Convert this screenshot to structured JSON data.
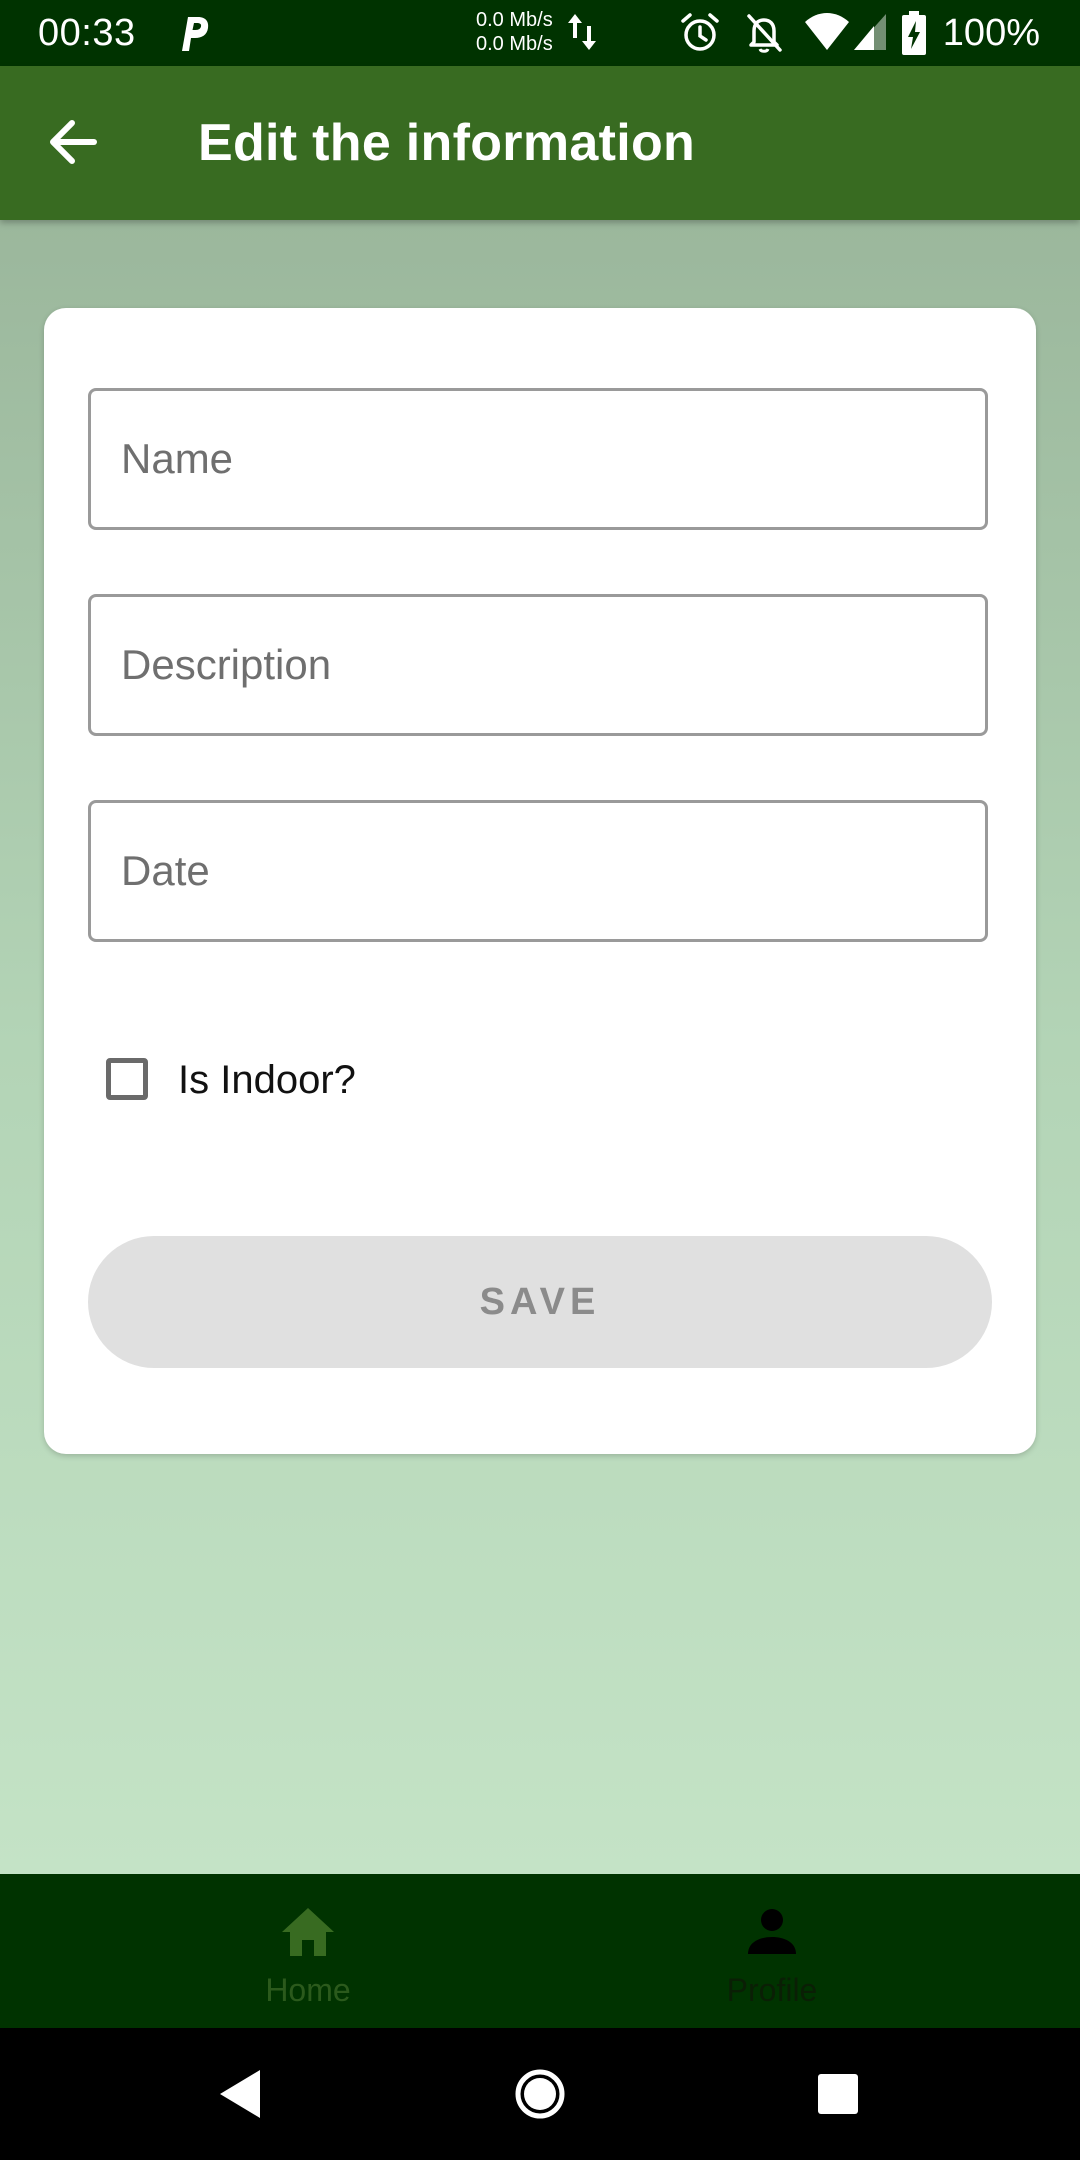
{
  "status_bar": {
    "time": "00:33",
    "net_up": "0.0 Mb/s",
    "net_down": "0.0 Mb/s",
    "battery": "100%",
    "icons": [
      "parking-icon",
      "data-arrows-icon",
      "alarm-icon",
      "bell-off-icon",
      "wifi-icon",
      "cell-signal-icon",
      "battery-charging-icon"
    ]
  },
  "app_bar": {
    "title": "Edit the information",
    "back_icon": "arrow-back-icon"
  },
  "form": {
    "name_placeholder": "Name",
    "description_placeholder": "Description",
    "date_placeholder": "Date",
    "indoor_label": "Is Indoor?",
    "indoor_checked": false,
    "save_label": "SAVE"
  },
  "bottom_nav": {
    "items": [
      {
        "label": "Home",
        "icon": "home-icon"
      },
      {
        "label": "Profile",
        "icon": "person-icon"
      }
    ]
  },
  "colors": {
    "status_bar": "#003300",
    "app_bar": "#386b21",
    "bottom_nav": "#003300",
    "save_disabled_bg": "#e0e0e0",
    "save_disabled_text": "#8b8b8b"
  }
}
